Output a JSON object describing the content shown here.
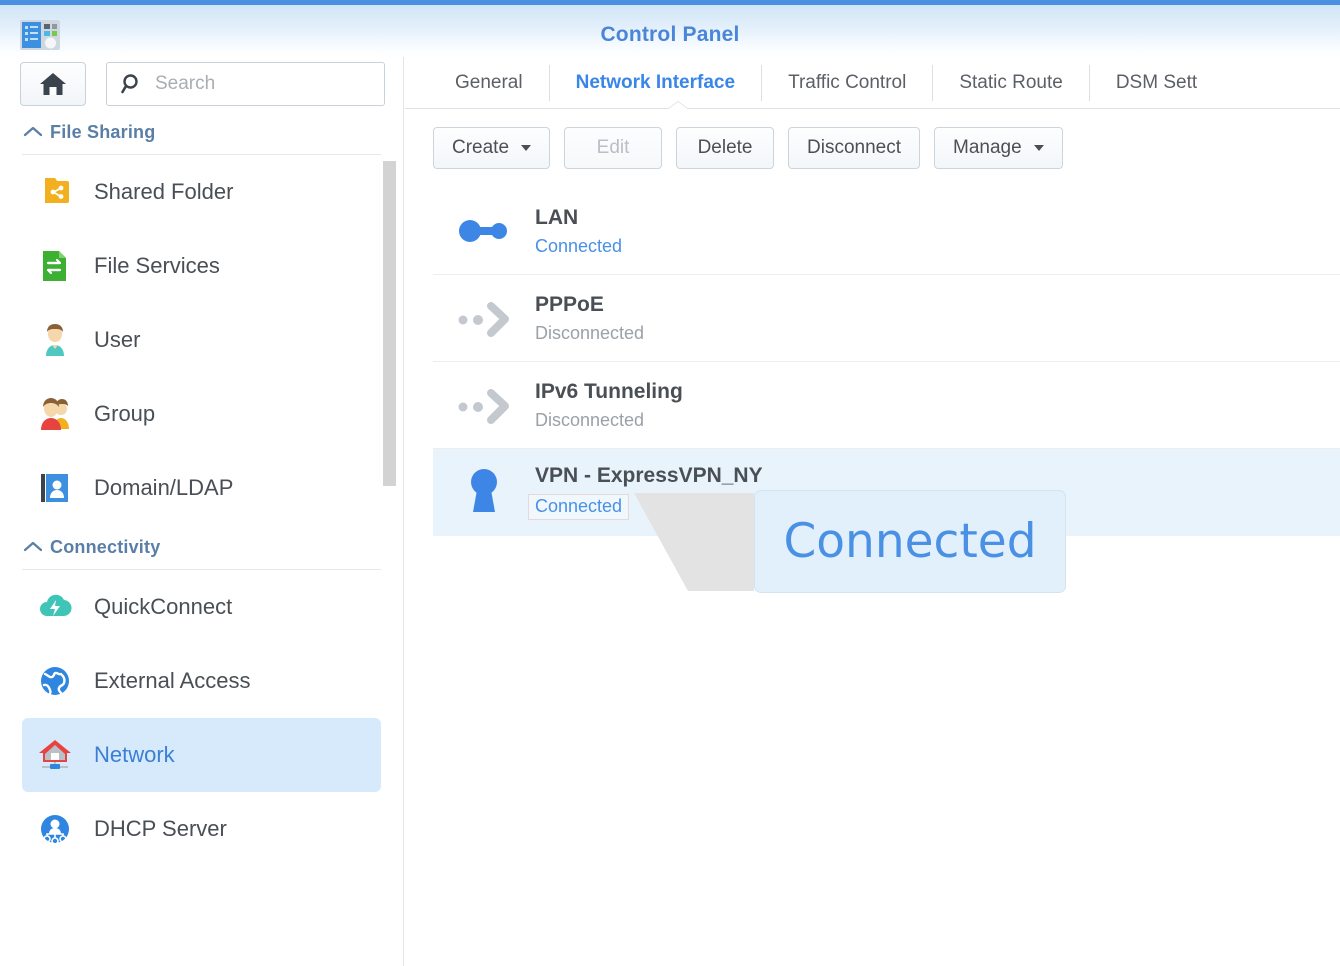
{
  "window": {
    "title": "Control Panel",
    "app_icon": "control-panel-icon",
    "accent_color": "#4a8fe0"
  },
  "sidebar": {
    "home_button": {
      "icon": "home-icon",
      "label": "Home"
    },
    "search": {
      "placeholder": "Search",
      "value": "",
      "icon": "search-icon"
    },
    "groups": [
      {
        "label": "File Sharing",
        "caret": "chevron-up-icon",
        "items": [
          {
            "label": "Shared Folder",
            "icon": "shared-folder-icon",
            "selected": false
          },
          {
            "label": "File Services",
            "icon": "file-services-icon",
            "selected": false
          },
          {
            "label": "User",
            "icon": "user-icon",
            "selected": false
          },
          {
            "label": "Group",
            "icon": "group-icon",
            "selected": false
          },
          {
            "label": "Domain/LDAP",
            "icon": "domain-ldap-icon",
            "selected": false
          }
        ]
      },
      {
        "label": "Connectivity",
        "caret": "chevron-up-icon",
        "items": [
          {
            "label": "QuickConnect",
            "icon": "quickconnect-icon",
            "selected": false
          },
          {
            "label": "External Access",
            "icon": "external-access-icon",
            "selected": false
          },
          {
            "label": "Network",
            "icon": "network-icon",
            "selected": true
          },
          {
            "label": "DHCP Server",
            "icon": "dhcp-server-icon",
            "selected": false
          }
        ]
      }
    ]
  },
  "main": {
    "tabs": [
      {
        "label": "General",
        "active": false
      },
      {
        "label": "Network Interface",
        "active": true
      },
      {
        "label": "Traffic Control",
        "active": false
      },
      {
        "label": "Static Route",
        "active": false
      },
      {
        "label": "DSM Sett",
        "active": false
      }
    ],
    "toolbar": [
      {
        "label": "Create",
        "has_caret": true,
        "disabled": false
      },
      {
        "label": "Edit",
        "has_caret": false,
        "disabled": true
      },
      {
        "label": "Delete",
        "has_caret": false,
        "disabled": false
      },
      {
        "label": "Disconnect",
        "has_caret": false,
        "disabled": false
      },
      {
        "label": "Manage",
        "has_caret": true,
        "disabled": false
      }
    ],
    "interfaces": [
      {
        "name": "LAN",
        "status": "Connected",
        "state": "connected",
        "icon": "lan-link-icon",
        "selected": false
      },
      {
        "name": "PPPoE",
        "status": "Disconnected",
        "state": "disconnected",
        "icon": "pppoe-arrow-icon",
        "selected": false
      },
      {
        "name": "IPv6 Tunneling",
        "status": "Disconnected",
        "state": "disconnected",
        "icon": "ipv6-tunnel-arrow-icon",
        "selected": false
      },
      {
        "name": "VPN - ExpressVPN_NY",
        "status": "Connected",
        "state": "connected",
        "icon": "vpn-keyhole-icon",
        "selected": true
      }
    ]
  },
  "callout": {
    "text": "Connected",
    "color": "#4a90e4",
    "background": "#e2f0fb"
  }
}
